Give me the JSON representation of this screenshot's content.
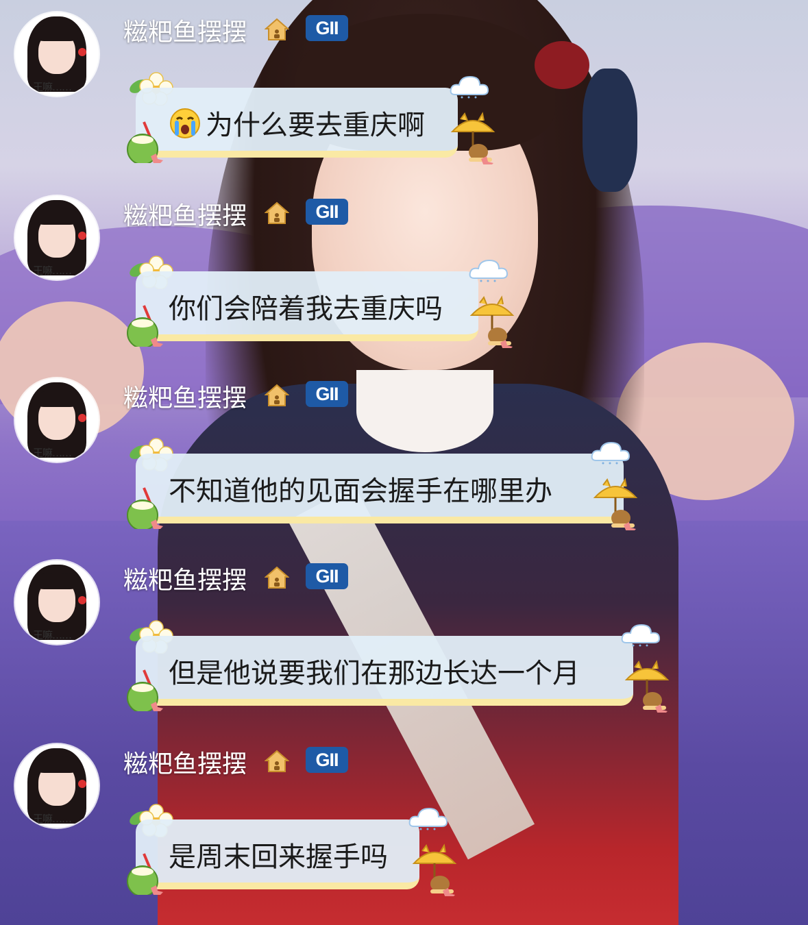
{
  "messages": [
    {
      "name": "糍粑鱼摆摆",
      "badge": "GII",
      "avatar_text": "王嘛……",
      "text": "为什么要去重庆啊",
      "emoji": "crying-face"
    },
    {
      "name": "糍粑鱼摆摆",
      "badge": "GII",
      "avatar_text": "王嘛……",
      "text": "你们会陪着我去重庆吗"
    },
    {
      "name": "糍粑鱼摆摆",
      "badge": "GII",
      "avatar_text": "王嘛……",
      "text": "不知道他的见面会握手在哪里办"
    },
    {
      "name": "糍粑鱼摆摆",
      "badge": "GII",
      "avatar_text": "王嘛……",
      "text": "但是他说要我们在那边长达一个月"
    },
    {
      "name": "糍粑鱼摆摆",
      "badge": "GII",
      "avatar_text": "王嘛……",
      "text": "是周末回来握手吗"
    }
  ],
  "colors": {
    "badge_bg": "#1e5aa6",
    "bubble_bg": "#e2eef8",
    "bubble_stripe": "#fae9a4",
    "name_text": "#ffffff"
  },
  "icons": [
    "house-icon",
    "flower-icon",
    "coconut-drink-icon",
    "cloud-icon",
    "cat-umbrella-icon",
    "crying-emoji-icon"
  ]
}
